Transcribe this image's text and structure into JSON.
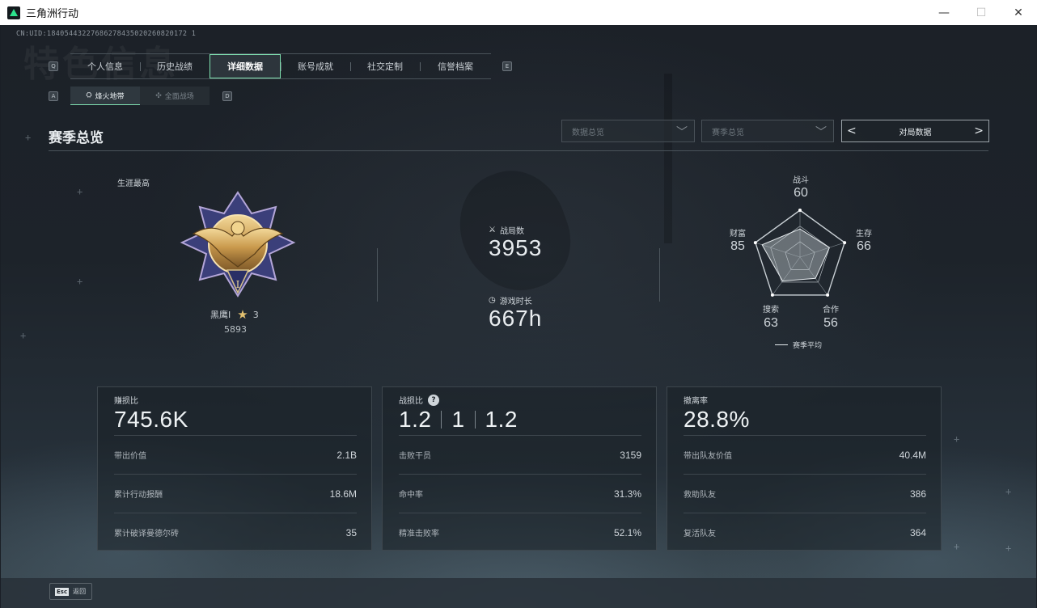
{
  "window": {
    "title": "三角洲行动",
    "minimize": "—",
    "maximize": "☐",
    "close": "✕"
  },
  "background": {
    "watermark": "特色信息"
  },
  "uid": "CN:UID:18405443227686278435020260820172 1",
  "tabs": {
    "left_key": "Q",
    "right_key": "E",
    "items": [
      {
        "label": "个人信息",
        "active": false
      },
      {
        "label": "历史战绩",
        "active": false
      },
      {
        "label": "详细数据",
        "active": true
      },
      {
        "label": "账号成就",
        "active": false
      },
      {
        "label": "社交定制",
        "active": false
      },
      {
        "label": "信誉档案",
        "active": false
      }
    ]
  },
  "subtabs": {
    "left_key": "A",
    "right_key": "D",
    "items": [
      {
        "label": "烽火地带",
        "icon": "extraction-icon",
        "active": true
      },
      {
        "label": "全面战场",
        "icon": "battlefield-icon",
        "active": false
      }
    ]
  },
  "section": {
    "title": "赛季总览",
    "select1": "数据总览",
    "select2": "赛季总览",
    "pager_label": "对局数据"
  },
  "rank": {
    "career_label": "生涯最高",
    "name": "黑鹰I",
    "stars": "3",
    "score": "5893"
  },
  "stats": {
    "matches_label": "战局数",
    "matches_value": "3953",
    "playtime_label": "游戏时长",
    "playtime_value": "667h"
  },
  "radar": {
    "axes": [
      {
        "name": "战斗",
        "value": "60",
        "score": 60
      },
      {
        "name": "生存",
        "value": "66",
        "score": 66
      },
      {
        "name": "合作",
        "value": "56",
        "score": 56
      },
      {
        "name": "搜索",
        "value": "63",
        "score": 63
      },
      {
        "name": "财富",
        "value": "85",
        "score": 85
      }
    ],
    "legend": "赛季平均"
  },
  "cards": [
    {
      "label": "赚损比",
      "big": "745.6K",
      "rows": [
        {
          "label": "带出价值",
          "value": "2.1B"
        },
        {
          "label": "累计行动报酬",
          "value": "18.6M"
        },
        {
          "label": "累计破译曼德尔砖",
          "value": "35"
        }
      ]
    },
    {
      "label": "战损比",
      "help": "?",
      "ratio": [
        "1.2",
        "1",
        "1.2"
      ],
      "rows": [
        {
          "label": "击败干员",
          "value": "3159"
        },
        {
          "label": "命中率",
          "value": "31.3%"
        },
        {
          "label": "精准击败率",
          "value": "52.1%"
        }
      ]
    },
    {
      "label": "撤离率",
      "big": "28.8%",
      "rows": [
        {
          "label": "带出队友价值",
          "value": "40.4M"
        },
        {
          "label": "救助队友",
          "value": "386"
        },
        {
          "label": "复活队友",
          "value": "364"
        }
      ]
    }
  ],
  "footer": {
    "esc_key": "Esc",
    "esc_label": "返回"
  }
}
